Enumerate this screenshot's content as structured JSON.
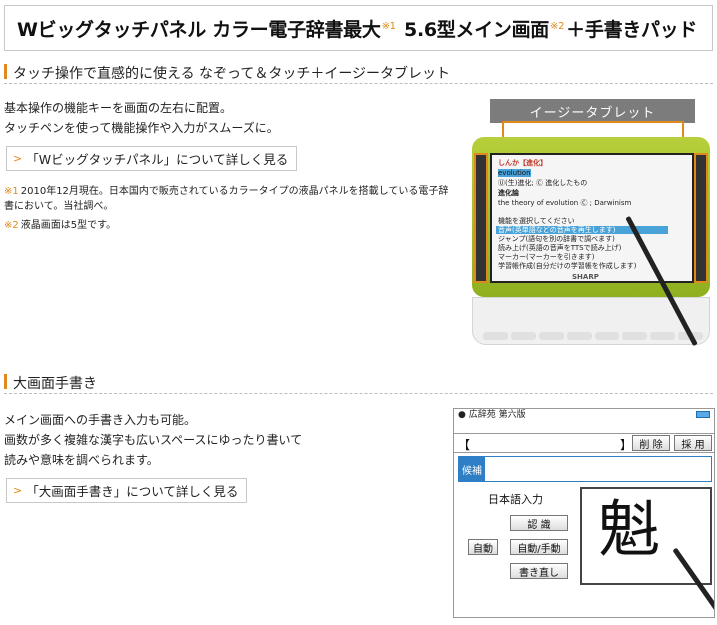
{
  "header": {
    "title_main": "Wビッグタッチパネル カラー電子辞書最大",
    "title_mark1": "※1",
    "title_size": " 5.6型メイン画面",
    "title_mark2": "※2",
    "title_tail": "＋手書きパッド"
  },
  "section1": {
    "heading": "タッチ操作で直感的に使える なぞって＆タッチ＋イージータブレット",
    "lines": [
      "基本操作の機能キーを画面の左右に配置。",
      "タッチペンを使って機能操作や入力がスムーズに。"
    ],
    "more_link": "「Wビッグタッチパネル」について詳しく見る",
    "notes": [
      {
        "mark": "※1",
        "text": "2010年12月現在。日本国内で販売されているカラータイプの液晶パネルを搭載している電子辞"
      },
      {
        "mark": "",
        "text": "書において。当社調べ。"
      },
      {
        "mark": "※2",
        "text": "液晶画面は5型です。"
      }
    ],
    "image": {
      "label": "イージータブレット",
      "screen_lines": [
        "しんか【進化】",
        "evolution",
        "Ⓤ(生)進化; Ⓒ 進化したもの",
        "進化論",
        "the theory of evolution Ⓒ ; Darwinism",
        "機能を選択してください",
        "音声(英単語などの音声を再生します)",
        "ジャンプ(語句を別の辞書で調べます)",
        "読み上げ(英語の音声をTTSで読み上げ)",
        "マーカー(マーカーを引きます)",
        "学習帳作成(自分だけの学習帳を作成します)"
      ],
      "brand": "SHARP"
    }
  },
  "section2": {
    "heading": "大画面手書き",
    "lines": [
      "メイン画面への手書き入力も可能。",
      "画数が多く複雑な漢字も広いスペースにゆったり書いて",
      "読みや意味を調べられます。"
    ],
    "more_link": "「大画面手書き」について詳しく見る",
    "image": {
      "dict_name": "● 広辞苑 第六版",
      "input_open": "【",
      "input_close": "】",
      "delete_btn": "削 除",
      "search_btn": "採 用",
      "candidate_label": "候補",
      "panel_title": "日本語入力",
      "recognize_btn": "認 識",
      "auto_badge": "自動",
      "auto_manual_btn": "自動/手動",
      "rewrite_btn": "書き直し",
      "handwritten": "魁"
    }
  }
}
